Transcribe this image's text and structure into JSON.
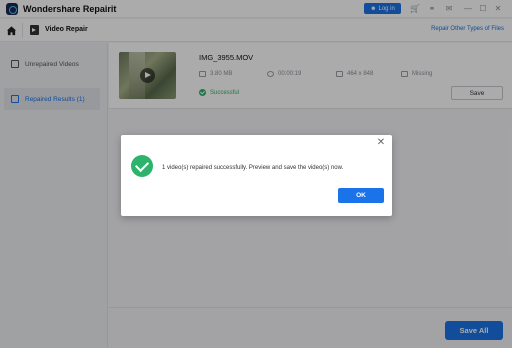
{
  "app": {
    "title": "Wondershare Repairit",
    "login_label": "Log in"
  },
  "nav": {
    "title": "Video Repair",
    "repair_other_label": "Repair Other Types of Files"
  },
  "sidebar": {
    "items": [
      {
        "label": "Unrepaired Videos",
        "active": false
      },
      {
        "label": "Repaired Results (1)",
        "active": true
      }
    ]
  },
  "video": {
    "filename": "IMG_3955.MOV",
    "size": "3.80 MB",
    "duration": "00:00:19",
    "resolution": "464 x 848",
    "extra": "Missing",
    "status": "Successful",
    "save_label": "Save"
  },
  "footer": {
    "save_all_label": "Save All"
  },
  "dialog": {
    "message": "1 video(s) repaired successfully. Preview and save the video(s) now.",
    "ok_label": "OK"
  },
  "colors": {
    "accent": "#1a73e8",
    "success": "#2db36b"
  }
}
